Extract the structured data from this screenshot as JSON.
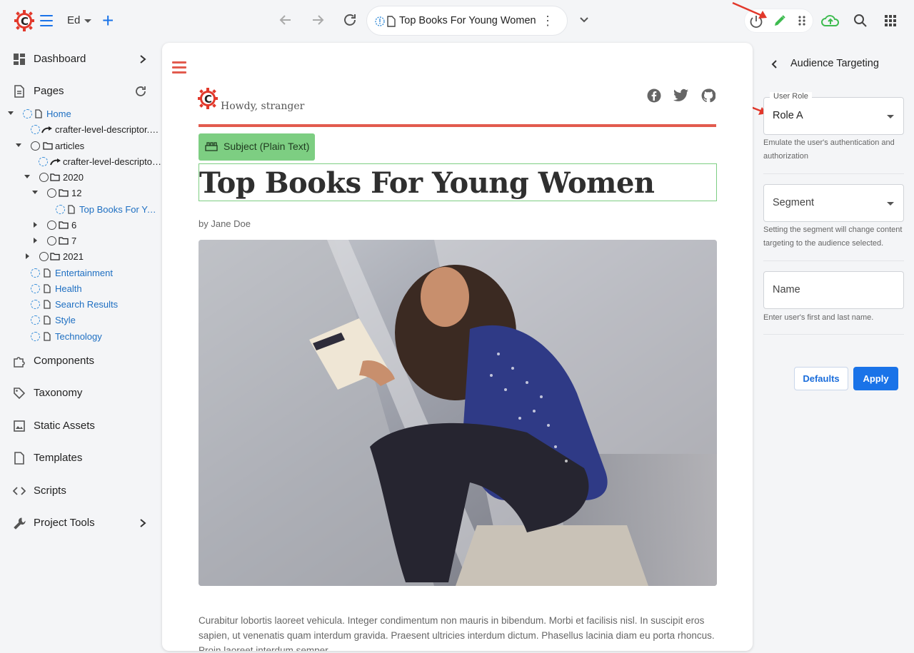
{
  "topbar": {
    "user_label": "Ed",
    "address": {
      "title": "Top Books For Young Women"
    },
    "colors": {
      "accent": "#1a73e8",
      "edit": "#3dbb4f",
      "publish": "#3dbb4f"
    }
  },
  "sidebar": {
    "items": [
      {
        "label": "Dashboard",
        "icon": "dashboard-icon",
        "chevron": true
      },
      {
        "label": "Pages",
        "icon": "page-icon",
        "refresh": true
      },
      {
        "label": "Components",
        "icon": "puzzle-icon"
      },
      {
        "label": "Taxonomy",
        "icon": "tag-icon"
      },
      {
        "label": "Static Assets",
        "icon": "image-icon"
      },
      {
        "label": "Templates",
        "icon": "page-icon"
      },
      {
        "label": "Scripts",
        "icon": "code-icon"
      },
      {
        "label": "Project Tools",
        "icon": "tools-icon",
        "chevron": true
      }
    ],
    "tree": [
      {
        "label": "Home",
        "kind": "page"
      },
      {
        "label": "crafter-level-descriptor.l…",
        "kind": "descriptor"
      },
      {
        "label": "articles",
        "kind": "folder"
      },
      {
        "label": "crafter-level-descriptor.…",
        "kind": "descriptor"
      },
      {
        "label": "2020",
        "kind": "folder"
      },
      {
        "label": "12",
        "kind": "folder"
      },
      {
        "label": "Top Books For You…",
        "kind": "page"
      },
      {
        "label": "6",
        "kind": "folder"
      },
      {
        "label": "7",
        "kind": "folder"
      },
      {
        "label": "2021",
        "kind": "folder"
      },
      {
        "label": "Entertainment",
        "kind": "page"
      },
      {
        "label": "Health",
        "kind": "page"
      },
      {
        "label": "Search Results",
        "kind": "page"
      },
      {
        "label": "Style",
        "kind": "page"
      },
      {
        "label": "Technology",
        "kind": "page"
      }
    ]
  },
  "preview": {
    "greeting": "Howdy, stranger",
    "subject_label": "Subject (Plain Text)",
    "title": "Top Books For Young Women",
    "byline": "by Jane Doe",
    "body": "Curabitur lobortis laoreet vehicula. Integer condimentum non mauris in bibendum. Morbi et facilisis nisl. In suscipit eros sapien, ut venenatis quam interdum gravida. Praesent ultricies interdum dictum. Phasellus lacinia diam eu porta rhoncus. Proin laoreet interdum semper.",
    "hero_alt": "woman reading a book sitting on a curb",
    "social_icons": [
      "facebook-icon",
      "twitter-icon",
      "github-icon"
    ]
  },
  "panel": {
    "title": "Audience Targeting",
    "user_role": {
      "label": "User Role",
      "value": "Role A",
      "help": "Emulate the user's authentication and authorization"
    },
    "segment": {
      "placeholder": "Segment",
      "help": "Setting the segment will change content targeting to the audience selected."
    },
    "name": {
      "placeholder": "Name",
      "help": "Enter user's first and last name."
    },
    "defaults_label": "Defaults",
    "apply_label": "Apply"
  }
}
